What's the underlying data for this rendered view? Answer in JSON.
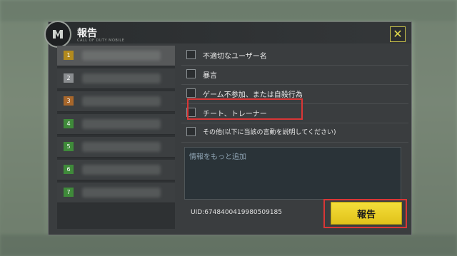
{
  "dialog": {
    "title": "報告",
    "subtitle": "CALL OF DUTY MOBILE",
    "close_icon": "close-x-icon"
  },
  "players": [
    {
      "rank": "1",
      "rank_color": "#b28a1e"
    },
    {
      "rank": "2",
      "rank_color": "#8a8d90"
    },
    {
      "rank": "3",
      "rank_color": "#a8672b"
    },
    {
      "rank": "4",
      "rank_color": "#3f8a3a"
    },
    {
      "rank": "5",
      "rank_color": "#3f8a3a"
    },
    {
      "rank": "6",
      "rank_color": "#3f8a3a"
    },
    {
      "rank": "7",
      "rank_color": "#3f8a3a"
    }
  ],
  "reasons": [
    {
      "label": "不適切なユーザー名"
    },
    {
      "label": "暴言"
    },
    {
      "label": "ゲーム不参加、または自殺行為"
    },
    {
      "label": "チート、トレーナー"
    },
    {
      "label": "その他(以下に当該の言動を説明してください)"
    }
  ],
  "comment": {
    "placeholder": "情報をもっと追加"
  },
  "uid": "UID:6748400419980509185",
  "report_button": "報告",
  "colors": {
    "accent_yellow": "#f0d835",
    "highlight_red": "#d93636"
  }
}
